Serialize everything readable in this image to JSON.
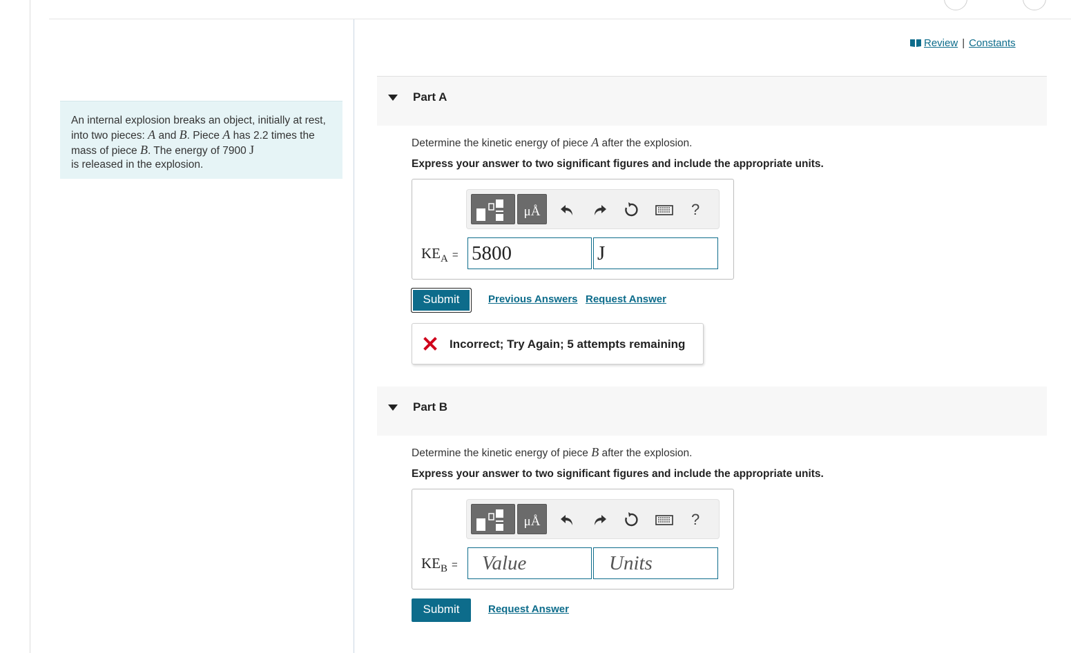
{
  "problem": {
    "pre": "An internal explosion breaks an object, initially at rest, into two pieces: ",
    "var_a": "A",
    "and": " and ",
    "var_b": "B",
    "mid1": ". Piece ",
    "var_a2": "A",
    "mid2": " has 2.2 times the mass of piece ",
    "var_b2": "B",
    "mid3": ". The energy of 7900 ",
    "unit_j": "J",
    "post": " is released in the explosion."
  },
  "links": {
    "review": "Review",
    "separator": "|",
    "constants": "Constants"
  },
  "part_a": {
    "title": "Part A",
    "question_pre": "Determine the kinetic energy of piece ",
    "question_var": "A",
    "question_post": " after the explosion.",
    "instructions": "Express your answer to two significant figures and include the appropriate units.",
    "toolbar": {
      "units_button": "μÅ",
      "help": "?"
    },
    "label_main": "KE",
    "label_sub": "A",
    "label_eq": "=",
    "value": "5800",
    "unit": "J",
    "submit": "Submit",
    "previous_answers": "Previous Answers",
    "request_answer": "Request Answer",
    "feedback": "Incorrect; Try Again; 5 attempts remaining"
  },
  "part_b": {
    "title": "Part B",
    "question_pre": "Determine the kinetic energy of piece ",
    "question_var": "B",
    "question_post": " after the explosion.",
    "instructions": "Express your answer to two significant figures and include the appropriate units.",
    "toolbar": {
      "units_button": "μÅ",
      "help": "?"
    },
    "label_main": "KE",
    "label_sub": "B",
    "label_eq": "=",
    "value_placeholder": "Value",
    "unit_placeholder": "Units",
    "submit": "Submit",
    "request_answer": "Request Answer"
  },
  "colors": {
    "accent": "#0d6c8b",
    "problem_bg": "#e6f4f6",
    "error": "#d0021b",
    "header_bg": "#f7f7f7"
  },
  "icons": [
    "book-icon",
    "templates-icon",
    "units-icon",
    "undo-icon",
    "redo-icon",
    "reset-icon",
    "keyboard-icon",
    "help-icon",
    "caret-down-icon",
    "error-x-icon"
  ]
}
